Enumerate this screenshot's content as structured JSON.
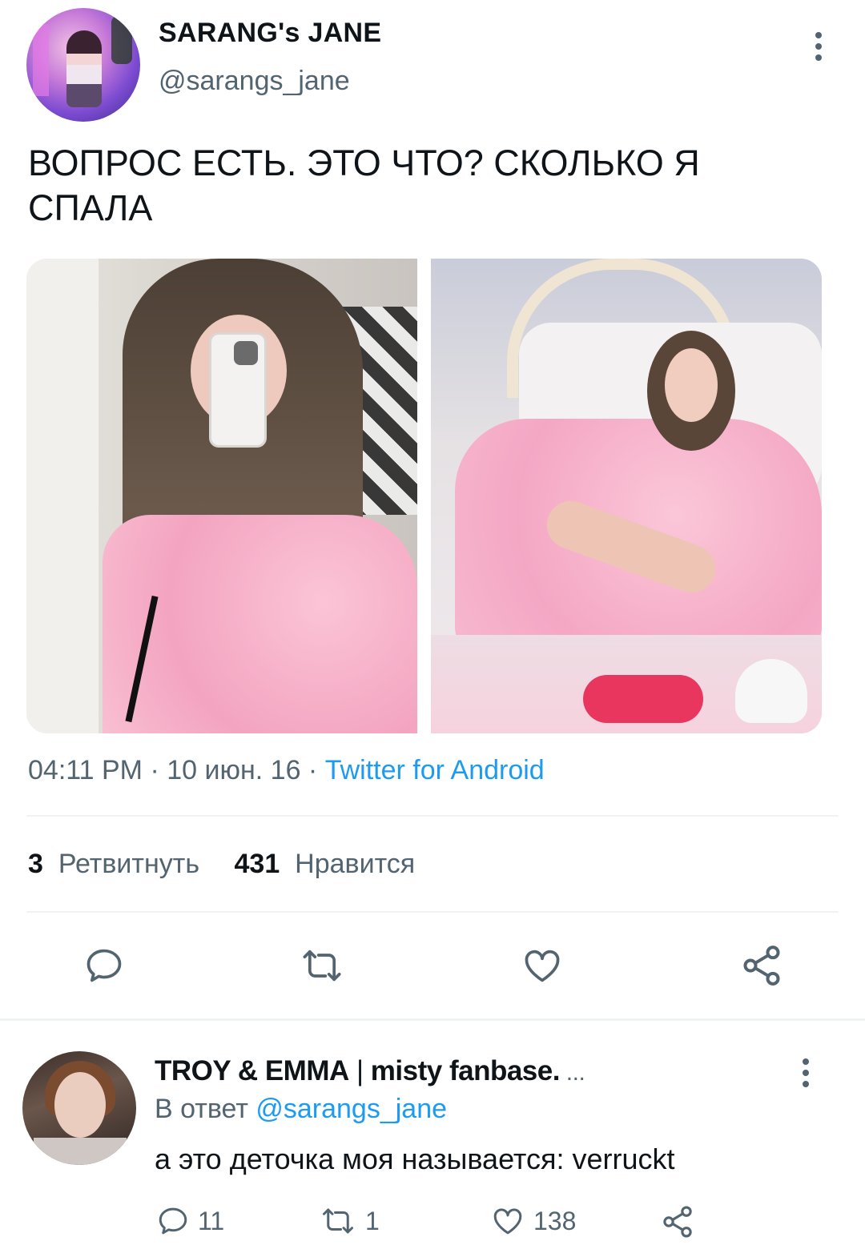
{
  "main_tweet": {
    "author_name": "SARANG's JANE",
    "author_handle": "@sarangs_jane",
    "text_line1": "ВОПРОС ЕСТЬ. ЭТО ЧТО? СКОЛЬКО Я",
    "text_line2": "СПАЛА",
    "meta": {
      "time": "04:11 PM",
      "sep1": " · ",
      "date": "10 июн. 16",
      "sep2": " · ",
      "client": "Twitter for Android"
    },
    "stats": {
      "retweets_count": "3",
      "retweets_label": "Ретвитнуть",
      "likes_count": "431",
      "likes_label": "Нравится"
    },
    "actions": [
      "reply-icon",
      "retweet-icon",
      "like-icon",
      "share-icon"
    ]
  },
  "reply_tweet": {
    "author_name_a": "TROY & EMMA",
    "author_name_sep": " | ",
    "author_name_b": "misty fanbase.",
    "author_name_ellipsis": " ...",
    "reply_prefix": "В ответ ",
    "reply_mention": "@sarangs_jane",
    "text": "а это деточка моя называется: verruckt",
    "reply_count": "11",
    "retweet_count": "1",
    "like_count": "138"
  },
  "colors": {
    "text": "#0f1419",
    "secondary": "#536471",
    "accent": "#1d9bf0",
    "divider": "#eff3f4"
  }
}
